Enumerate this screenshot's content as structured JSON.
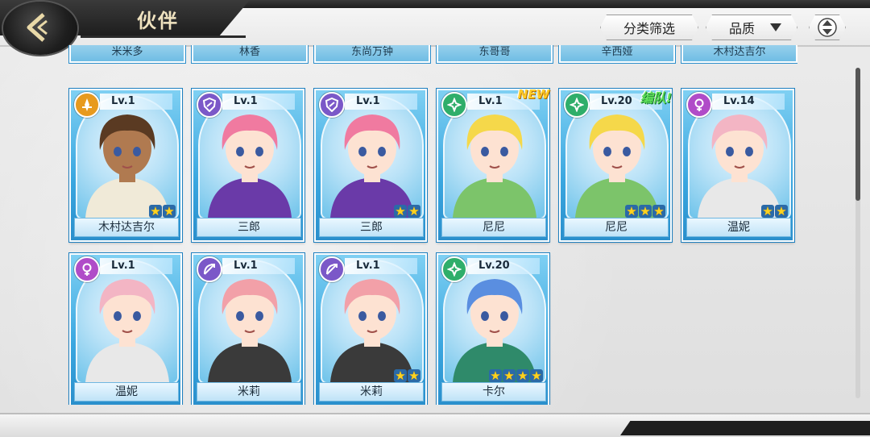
{
  "header": {
    "title": "伙伴",
    "filter_label": "分类筛选",
    "quality_label": "品质"
  },
  "colors": {
    "attack": "#e79a1e",
    "defense": "#7b58c8",
    "heal": "#2fae6a",
    "magic": "#b04cc8"
  },
  "prev_row_names": [
    "米米多",
    "林香",
    "东尚万钟",
    "东哥哥",
    "辛西娅",
    "木村达吉尔"
  ],
  "cards": [
    {
      "name": "木村达吉尔",
      "level": "Lv.1",
      "icon": "attack-icon",
      "stars": 2,
      "tag": ""
    },
    {
      "name": "三郎",
      "level": "Lv.1",
      "icon": "shield-icon",
      "stars": 0,
      "tag": ""
    },
    {
      "name": "三郎",
      "level": "Lv.1",
      "icon": "shield-icon",
      "stars": 2,
      "tag": ""
    },
    {
      "name": "尼尼",
      "level": "Lv.1",
      "icon": "clover-icon",
      "stars": 0,
      "tag": "NEW"
    },
    {
      "name": "尼尼",
      "level": "Lv.20",
      "icon": "clover-icon",
      "stars": 3,
      "tag": "编队!"
    },
    {
      "name": "温妮",
      "level": "Lv.14",
      "icon": "venus-icon",
      "stars": 2,
      "tag": ""
    },
    {
      "name": "温妮",
      "level": "Lv.1",
      "icon": "venus-icon",
      "stars": 0,
      "tag": ""
    },
    {
      "name": "米莉",
      "level": "Lv.1",
      "icon": "bow-icon",
      "stars": 0,
      "tag": ""
    },
    {
      "name": "米莉",
      "level": "Lv.1",
      "icon": "bow-icon",
      "stars": 2,
      "tag": ""
    },
    {
      "name": "卡尔",
      "level": "Lv.20",
      "icon": "clover-icon",
      "stars": 4,
      "tag": ""
    }
  ]
}
